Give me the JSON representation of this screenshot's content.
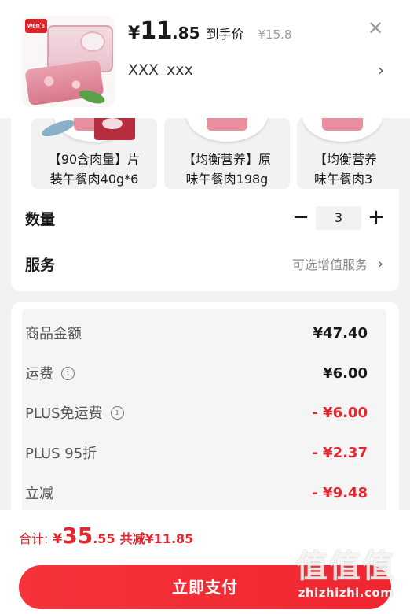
{
  "header": {
    "brand_logo": "wen's",
    "price_symbol": "¥",
    "price_integer": "11",
    "price_decimal": ".85",
    "price_tag": "到手价",
    "original_price": "¥15.8",
    "close_icon": "close-icon",
    "spec_text_a": "XXX",
    "spec_text_b": "xxx",
    "spec_arrow": "›"
  },
  "variants": [
    {
      "label": "【90含肉量】片\n装午餐肉40g*6"
    },
    {
      "label": "【均衡营养】原\n味午餐肉198g"
    },
    {
      "label": "【均衡营养\n味午餐肉3"
    }
  ],
  "quantity": {
    "label": "数量",
    "minus": "−",
    "value": "3",
    "plus": "+"
  },
  "service": {
    "label": "服务",
    "value": "可选增值服务",
    "arrow": "›"
  },
  "fees": [
    {
      "label": "商品金额",
      "value": "¥47.40",
      "info": false,
      "red": false
    },
    {
      "label": "运费",
      "value": "¥6.00",
      "info": true,
      "red": false
    },
    {
      "label": "PLUS免运费",
      "value": "- ¥6.00",
      "info": true,
      "red": true
    },
    {
      "label": "PLUS 95折",
      "value": "- ¥2.37",
      "info": false,
      "red": true
    },
    {
      "label": "立减",
      "value": "- ¥9.48",
      "info": false,
      "red": true
    }
  ],
  "footer": {
    "total_label": "合计:",
    "total_symbol": "¥",
    "total_integer": "35",
    "total_decimal": ".55",
    "total_saving": "共减¥11.85",
    "pay_button": "立即支付"
  },
  "watermark": {
    "logo_text": "值值值",
    "url": "zhizhizhi.com"
  },
  "colors": {
    "accent_red": "#e4262e",
    "button_red": "#f5333b",
    "background": "#f2f2f2"
  }
}
